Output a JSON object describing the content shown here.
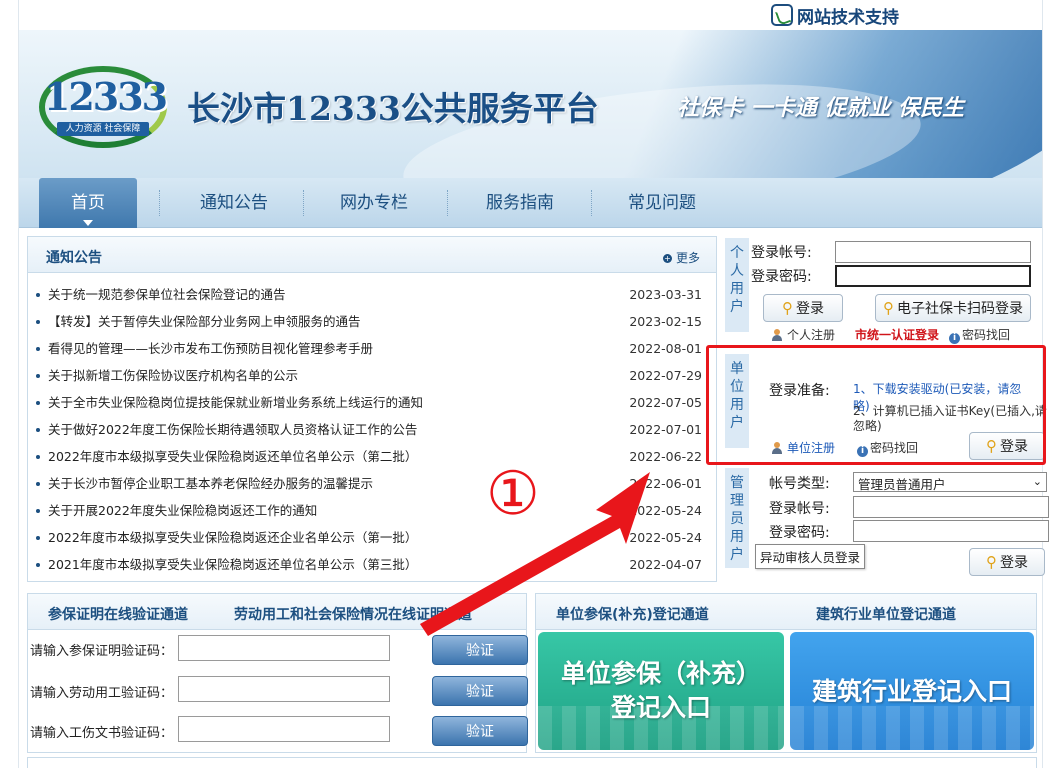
{
  "header": {
    "support_label": "网站技术支持",
    "logo_number": "12333",
    "logo_subtitle": "人力资源 社会保障",
    "site_title": "长沙市12333公共服务平台",
    "slogan": "社保卡 一卡通 促就业 保民生"
  },
  "nav": {
    "items": [
      "首页",
      "通知公告",
      "网办专栏",
      "服务指南",
      "常见问题"
    ]
  },
  "notice": {
    "title": "通知公告",
    "more": "更多",
    "items": [
      {
        "title": "关于统一规范参保单位社会保险登记的通告",
        "date": "2023-03-31"
      },
      {
        "title": "【转发】关于暂停失业保险部分业务网上申领服务的通告",
        "date": "2023-02-15"
      },
      {
        "title": "看得见的管理——长沙市发布工伤预防目视化管理参考手册",
        "date": "2022-08-01"
      },
      {
        "title": "关于拟新增工伤保险协议医疗机构名单的公示",
        "date": "2022-07-29"
      },
      {
        "title": "关于全市失业保险稳岗位提技能保就业新增业务系统上线运行的通知",
        "date": "2022-07-05"
      },
      {
        "title": "关于做好2022年度工伤保险长期待遇领取人员资格认证工作的公告",
        "date": "2022-07-01"
      },
      {
        "title": "2022年度市本级拟享受失业保险稳岗返还单位名单公示（第二批）",
        "date": "2022-06-22"
      },
      {
        "title": "关于长沙市暂停企业职工基本养老保险经办服务的温馨提示",
        "date": "2022-06-01"
      },
      {
        "title": "关于开展2022年度失业保险稳岗返还工作的通知",
        "date": "2022-05-24"
      },
      {
        "title": "2022年度市本级拟享受失业保险稳岗返还企业名单公示（第一批）",
        "date": "2022-05-24"
      },
      {
        "title": "2021年度市本级拟享受失业保险稳岗返还单位名单公示（第三批）",
        "date": "2022-04-07"
      }
    ]
  },
  "login": {
    "personal": {
      "tab": "个人用户",
      "account_label": "登录帐号:",
      "password_label": "登录密码:",
      "login_button": "登录",
      "scan_button": "电子社保卡扫码登录",
      "register": "个人注册",
      "unified": "市统一认证登录",
      "recover": "密码找回"
    },
    "unit": {
      "tab": "单位用户",
      "prep_label": "登录准备:",
      "step1": "1、下载安装驱动(已安装，请忽略)",
      "step2": "2、计算机已插入证书Key(已插入,请忽略)",
      "register": "单位注册",
      "recover": "密码找回",
      "login_button": "登录"
    },
    "admin": {
      "tab": "管理员用户",
      "type_label": "帐号类型:",
      "type_value": "管理员普通用户",
      "account_label": "登录帐号:",
      "password_label": "登录密码:",
      "remote_button": "异动审核人员登录",
      "login_button": "登录"
    }
  },
  "verify": {
    "tab1": "参保证明在线验证通道",
    "tab2": "劳动用工和社会保险情况在线证明通道",
    "rows": [
      {
        "label": "请输入参保证明验证码：",
        "button": "验证"
      },
      {
        "label": "请输入劳动用工验证码：",
        "button": "验证"
      },
      {
        "label": "请输入工伤文书验证码：",
        "button": "验证"
      }
    ]
  },
  "entry": {
    "tab1": "单位参保(补充)登记通道",
    "tab2": "建筑行业单位登记通道",
    "tile1_line1": "单位参保（补充）",
    "tile1_line2": "登记入口",
    "tile2_line1": "建筑行业登记入口"
  },
  "annotation": {
    "marker": "①",
    "color": "#e8161b"
  }
}
